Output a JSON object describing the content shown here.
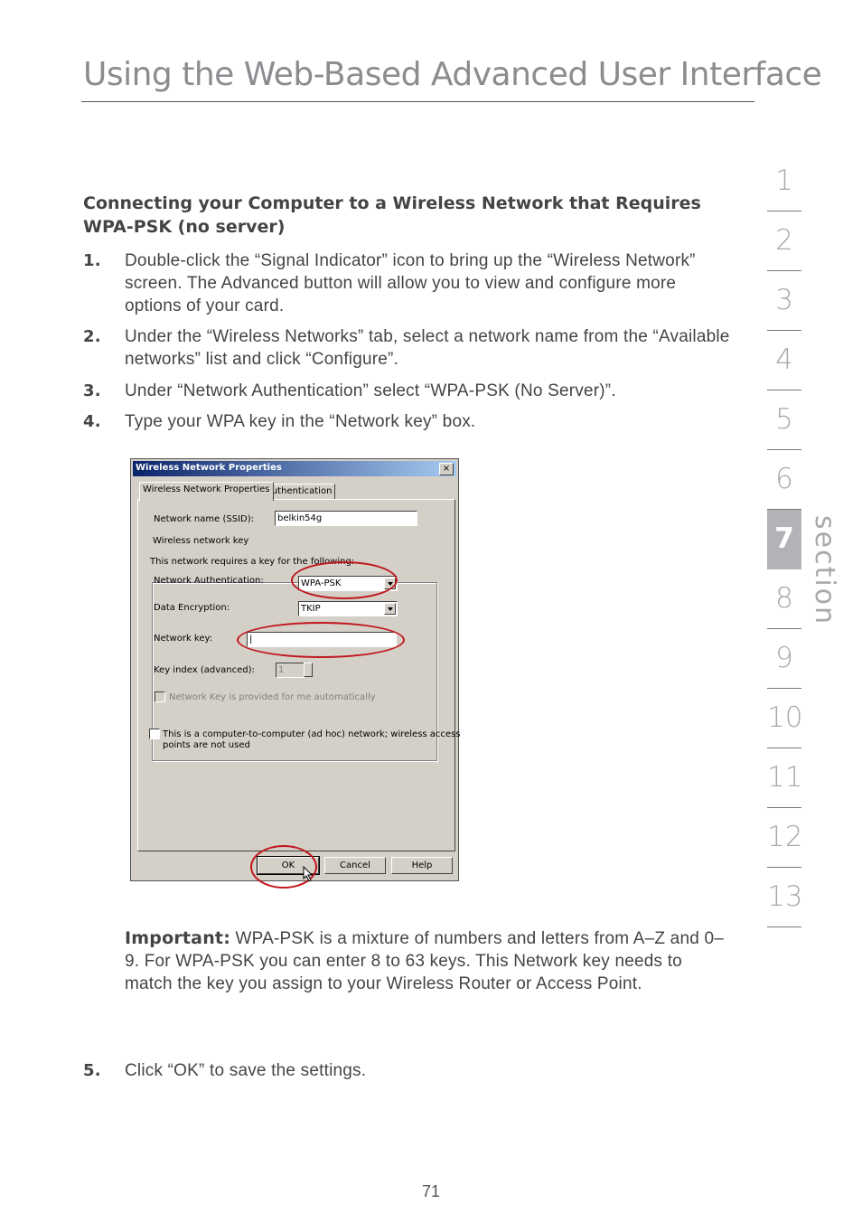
{
  "header": {
    "title": "Using the Web-Based Advanced User Interface"
  },
  "section_heading": "Connecting your Computer to a Wireless Network that Requires WPA-PSK (no server)",
  "steps": [
    {
      "num": "1.",
      "text": "Double-click the “Signal Indicator” icon to bring up the “Wireless Network” screen. The Advanced button will allow you to view and configure more options of your card."
    },
    {
      "num": "2.",
      "text": "Under the “Wireless Networks” tab, select a network name from the “Available networks” list and click “Configure”."
    },
    {
      "num": "3.",
      "text": "Under “Network Authentication” select “WPA-PSK (No Server)”."
    },
    {
      "num": "4.",
      "text": "Type your WPA key in the “Network key” box."
    },
    {
      "num": "5.",
      "text": "Click “OK” to save the settings."
    }
  ],
  "important": {
    "label": "Important:",
    "text": " WPA-PSK is a mixture of numbers and letters from A–Z and 0–9. For WPA-PSK you can enter 8 to 63 keys. This Network key needs to match the key you assign to your Wireless Router or Access Point."
  },
  "page_number": "71",
  "sidebar": {
    "word": "section",
    "active": "7",
    "items": [
      "1",
      "2",
      "3",
      "4",
      "5",
      "6",
      "7",
      "8",
      "9",
      "10",
      "11",
      "12",
      "13"
    ]
  },
  "dialog": {
    "title": "Wireless Network Properties",
    "close": "×",
    "tabs": [
      "Wireless Network Properties",
      "Authentication"
    ],
    "ssid_label": "Network name (SSID):",
    "ssid_value": "belkin54g",
    "group_label": "Wireless network key",
    "group_note": "This network requires a key for the following:",
    "auth_label": "Network Authentication:",
    "auth_value": "WPA-PSK",
    "enc_label": "Data Encryption:",
    "enc_value": "TKIP",
    "key_label": "Network key:",
    "key_value": "|",
    "index_label": "Key index (advanced):",
    "index_value": "1",
    "auto_key_label": "Network Key is provided for me automatically",
    "adhoc_label_1": "This is a computer-to-computer (ad hoc) network; wireless access",
    "adhoc_label_2": "points are not used",
    "ok": "OK",
    "cancel": "Cancel",
    "help": "Help",
    "highlight_color": "#c0161c"
  }
}
